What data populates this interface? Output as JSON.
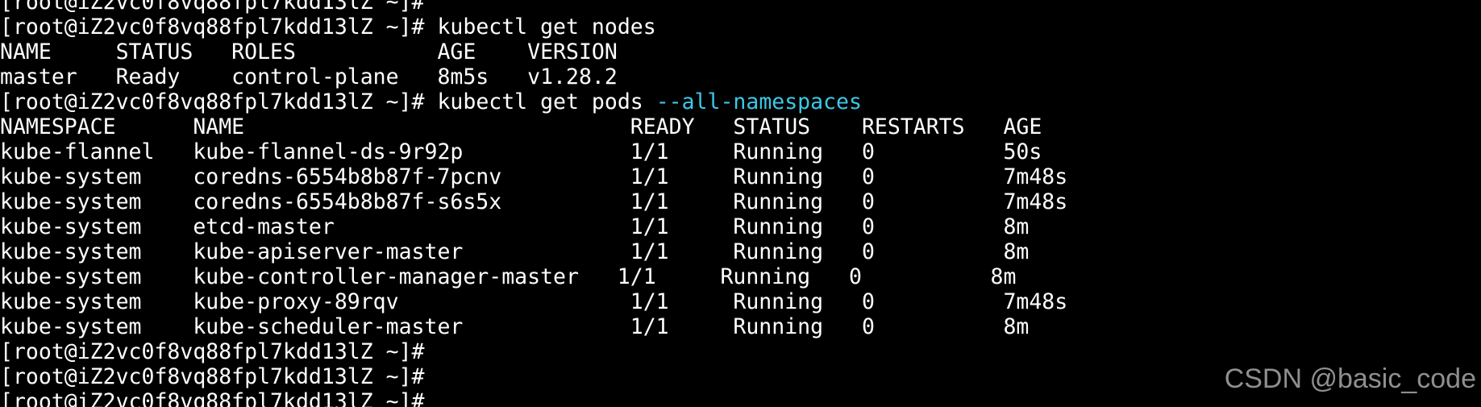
{
  "app": {
    "type": "terminal",
    "colors": {
      "background": "#000000",
      "foreground": "#ffffff",
      "argument": "#3cc8e8",
      "watermark": "#8f8f8f"
    }
  },
  "terminal": {
    "prompt": "[root@iZ2vc0f8vq88fpl7kdd13lZ ~]# ",
    "line_prev": "[root@iZ2vc0f8vq88fpl7kdd13lZ ~]#",
    "cmd_nodes": "kubectl get nodes",
    "nodes_header": "NAME     STATUS   ROLES           AGE    VERSION",
    "nodes_row": "master   Ready    control-plane   8m5s   v1.28.2",
    "cmd_pods": "kubectl get pods ",
    "cmd_pods_arg": "--all-namespaces",
    "pods_header": "NAMESPACE      NAME                              READY   STATUS    RESTARTS   AGE",
    "pods_rows": [
      "kube-flannel   kube-flannel-ds-9r92p             1/1     Running   0          50s",
      "kube-system    coredns-6554b8b87f-7pcnv          1/1     Running   0          7m48s",
      "kube-system    coredns-6554b8b87f-s6s5x          1/1     Running   0          7m48s",
      "kube-system    etcd-master                       1/1     Running   0          8m",
      "kube-system    kube-apiserver-master             1/1     Running   0          8m",
      "kube-system    kube-controller-manager-master   1/1     Running   0          8m",
      "kube-system    kube-proxy-89rqv                  1/1     Running   0          7m48s",
      "kube-system    kube-scheduler-master             1/1     Running   0          8m"
    ],
    "prompt_1": "[root@iZ2vc0f8vq88fpl7kdd13lZ ~]#",
    "prompt_2": "[root@iZ2vc0f8vq88fpl7kdd13lZ ~]#",
    "prompt_3": "[root@iZ2vc0f8vq88fpl7kdd13lZ ~]#"
  },
  "watermark": {
    "text": "CSDN @basic_code"
  }
}
